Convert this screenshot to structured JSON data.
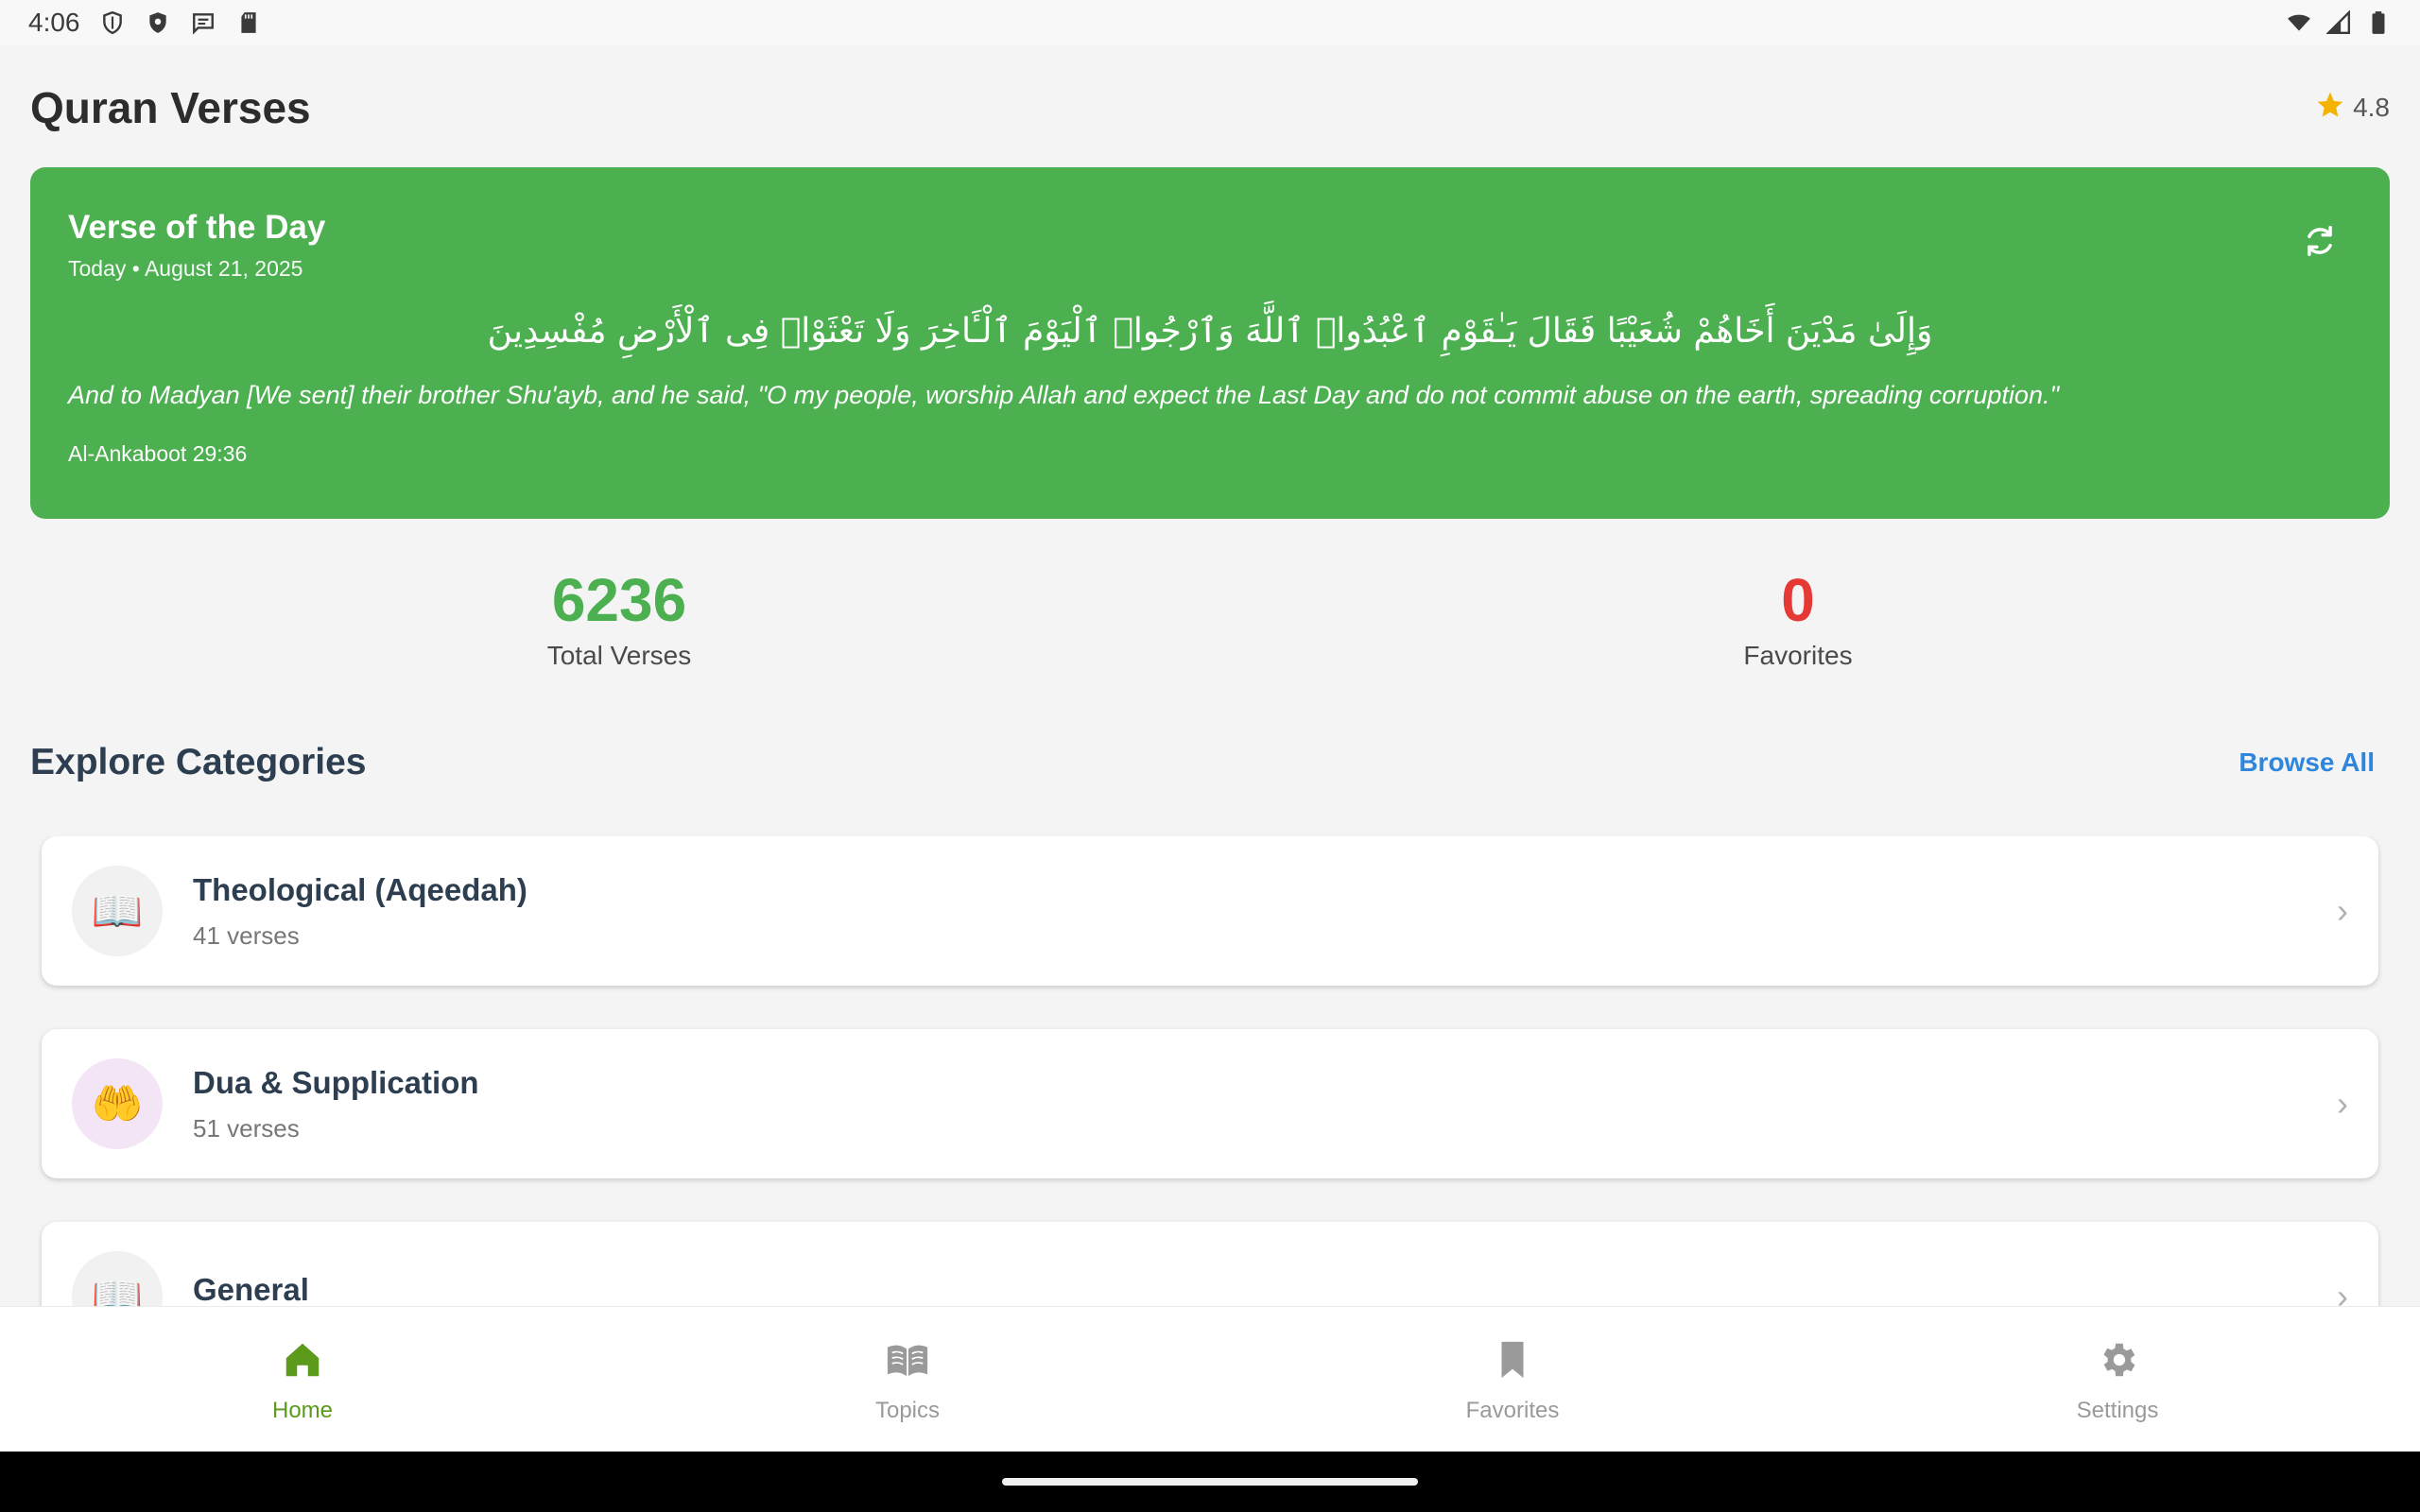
{
  "status_bar": {
    "time": "4:06",
    "left_icons": [
      "shield-outline-icon",
      "shield-filled-icon",
      "message-icon",
      "sd-card-icon"
    ],
    "right_icons": [
      "wifi-icon",
      "signal-icon",
      "battery-icon"
    ]
  },
  "header": {
    "title": "Quran Verses",
    "rating": "4.8",
    "rating_icon": "star-icon",
    "rating_color": "#f5b301"
  },
  "verse_of_day": {
    "heading": "Verse of the Day",
    "date": "Today • August 21, 2025",
    "arabic": "وَإِلَىٰ مَدْيَنَ أَخَاهُمْ شُعَيْبًا فَقَالَ يَـٰقَوْمِ ٱعْبُدُوا۟ ٱللَّهَ وَٱرْجُوا۟ ٱلْيَوْمَ ٱلْـَٔاخِرَ وَلَا تَعْثَوْا۟ فِى ٱلْأَرْضِ مُفْسِدِينَ",
    "translation": "And to Madyan [We sent] their brother Shu'ayb, and he said, \"O my people, worship Allah and expect the Last Day and do not commit abuse on the earth, spreading corruption.\"",
    "reference": "Al-Ankaboot 29:36",
    "refresh_icon": "refresh-icon",
    "card_color": "#4caf50"
  },
  "stats": {
    "total_verses": {
      "value": "6236",
      "label": "Total Verses",
      "color": "#4caf50"
    },
    "favorites": {
      "value": "0",
      "label": "Favorites",
      "color": "#e53935"
    }
  },
  "categories_section": {
    "title": "Explore Categories",
    "browse_all": "Browse All",
    "items": [
      {
        "name": "Theological (Aqeedah)",
        "count": "41 verses",
        "icon": "📖",
        "icon_name": "open-book-icon",
        "icon_bg": "#f1f1f1"
      },
      {
        "name": "Dua & Supplication",
        "count": "51 verses",
        "icon": "🤲",
        "icon_name": "praying-hands-icon",
        "icon_bg": "#f3e5f5"
      },
      {
        "name": "General",
        "count": "",
        "icon": "📖",
        "icon_name": "open-book-icon",
        "icon_bg": "#f1f1f1"
      }
    ]
  },
  "bottom_nav": {
    "active_color": "#5b9a1a",
    "items": [
      {
        "label": "Home",
        "icon": "home-icon",
        "active": true
      },
      {
        "label": "Topics",
        "icon": "book-icon",
        "active": false
      },
      {
        "label": "Favorites",
        "icon": "bookmark-icon",
        "active": false
      },
      {
        "label": "Settings",
        "icon": "gear-icon",
        "active": false
      }
    ]
  }
}
